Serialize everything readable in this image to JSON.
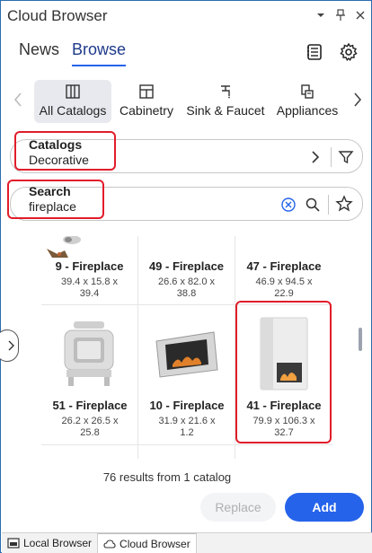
{
  "window": {
    "title": "Cloud Browser",
    "controls": [
      "chevron-down-icon",
      "pin-icon",
      "close-icon"
    ]
  },
  "tabs": [
    {
      "label": "News",
      "active": false
    },
    {
      "label": "Browse",
      "active": true
    }
  ],
  "categories": [
    {
      "label": "All Catalogs",
      "icon": "catalogs-icon",
      "active": true
    },
    {
      "label": "Cabinetry",
      "icon": "cabinetry-icon",
      "active": false
    },
    {
      "label": "Sink & Faucet",
      "icon": "faucet-icon",
      "active": false
    },
    {
      "label": "Appliances",
      "icon": "appliances-icon",
      "active": false
    }
  ],
  "catalogs": {
    "label": "Catalogs",
    "value": "Decorative"
  },
  "search": {
    "label": "Search",
    "value": "fireplace"
  },
  "items": [
    {
      "name": "9 - Fireplace",
      "dims": "39.4 x  15.8 x",
      "dims2": "39.4"
    },
    {
      "name": "49 - Fireplace",
      "dims": "26.6 x  82.0 x",
      "dims2": "38.8"
    },
    {
      "name": "47 - Fireplace",
      "dims": "46.9 x  94.5 x",
      "dims2": "22.9"
    },
    {
      "name": "51 - Fireplace",
      "dims": "26.2 x  26.5 x",
      "dims2": "25.8"
    },
    {
      "name": "10 - Fireplace",
      "dims": "31.9 x  21.6 x",
      "dims2": "1.2"
    },
    {
      "name": "41 - Fireplace",
      "dims": "79.9 x  106.3 x",
      "dims2": "32.7",
      "selected": true
    }
  ],
  "results_text": "76 results from 1 catalog",
  "actions": {
    "replace": "Replace",
    "add": "Add"
  },
  "bottom_tabs": [
    {
      "label": "Local Browser",
      "active": false
    },
    {
      "label": "Cloud Browser",
      "active": true
    }
  ],
  "colors": {
    "accent": "#2563eb",
    "highlight": "#e11d2b"
  }
}
